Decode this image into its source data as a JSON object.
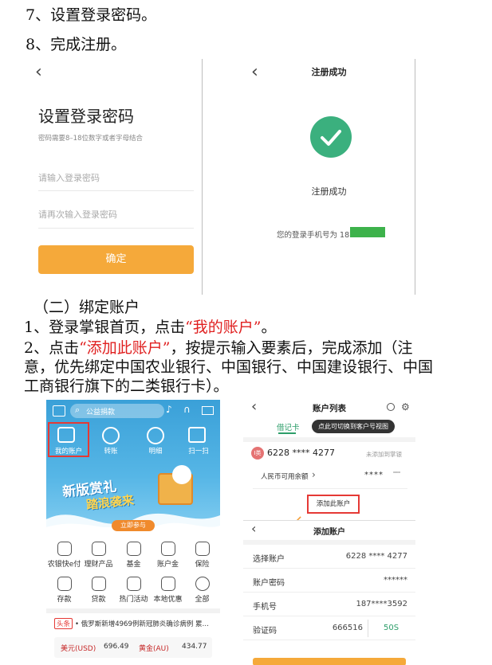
{
  "steps": {
    "step7": "7、设置登录密码。",
    "step8": "8、完成注册。"
  },
  "set_password_screen": {
    "back": "‹",
    "title": "设置登录密码",
    "hint": "密码需要8–18位数字或者字母结合",
    "password_placeholder": "请输入登录密码",
    "confirm_placeholder": "请再次输入登录密码",
    "confirm_button": "确定"
  },
  "success_screen": {
    "back": "‹",
    "header": "注册成功",
    "status": "注册成功",
    "phone_text": "您的登录手机号为 187",
    "colors": {
      "check": "#3bb07e",
      "mask": "#3db24b"
    }
  },
  "section": {
    "title": "（二）绑定账户",
    "p1_prefix": "1、登录掌银首页，点击",
    "p1_highlight": "“我的账户”",
    "p1_suffix": "。",
    "p2_prefix": "2、点击",
    "p2_highlight": "“添加此账户”",
    "p2_suffix": "，按提示输入要素后，完成添加（注",
    "p2_line2": "意，优先绑定中国农业银行、中国银行、中国建设银行、中国",
    "p2_line3": "工商银行旗下的二类银行卡）。"
  },
  "bank_app": {
    "search_placeholder": "公益捐款",
    "quick": [
      "我的账户",
      "转账",
      "明细",
      "扫一扫"
    ],
    "banner_line1": "新版赏礼",
    "banner_line2": "踏浪袭来",
    "banner_btn": "立即参与",
    "menu_row1": [
      "农银快e付",
      "理财产品",
      "基金",
      "账户金",
      "保险"
    ],
    "menu_row2": [
      "存款",
      "贷款",
      "热门活动",
      "本地优惠",
      "全部"
    ],
    "news_tag": "头条",
    "news_text": "• 俄罗斯新增4969例新冠肺炎确诊病例 累…",
    "fx1_label": "美元(USD)",
    "fx1_value": "696.49",
    "fx2_label": "黄金(AU)",
    "fx2_value": "434.77"
  },
  "account_list": {
    "back": "‹",
    "title": "账户列表",
    "tab": "借记卡",
    "tooltip": "点此可切换到客户号视图",
    "card_badge": "I类",
    "card_number": "6228 **** 4277",
    "card_status": "未添加到掌银",
    "balance_label": "人民币可用余额",
    "balance_arrow": "›",
    "balance_mask": "****",
    "add_button": "添加此账户",
    "add_header": "添加账户",
    "rows": [
      {
        "label": "选择账户",
        "value": "6228 **** 4277"
      },
      {
        "label": "账户密码",
        "value": "******"
      },
      {
        "label": "手机号",
        "value": "187****3592"
      },
      {
        "label": "验证码",
        "value": "666516"
      }
    ],
    "sms_button": "50S"
  }
}
